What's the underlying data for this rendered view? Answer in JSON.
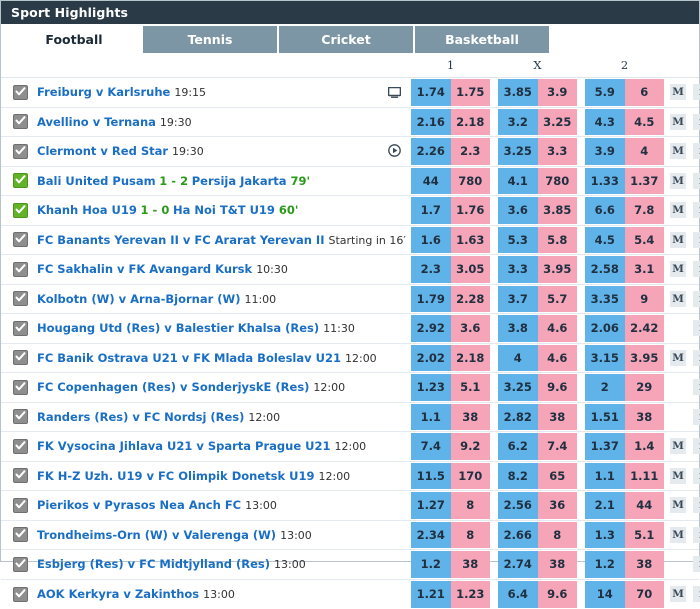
{
  "header": {
    "title": "Sport Highlights"
  },
  "tabs": [
    {
      "label": "Football",
      "active": true
    },
    {
      "label": "Tennis",
      "active": false
    },
    {
      "label": "Cricket",
      "active": false
    },
    {
      "label": "Basketball",
      "active": false
    }
  ],
  "column_headers": [
    "1",
    "X",
    "2"
  ],
  "buttons": {
    "more_label": "M",
    "info_label": "i"
  },
  "colors": {
    "titlebar": "#2b3a47",
    "tab_inactive": "#7d96a5",
    "odd_blue": "#5fb3e8",
    "odd_pink": "#f6a5b8",
    "team_link": "#1a6fc4",
    "live_green": "#2a9a18",
    "checkbox_gray": "#8e8e8e",
    "checkbox_green": "#62b32a"
  },
  "rows": [
    {
      "teams": "Freiburg v Karlsruhe",
      "time": "19:15",
      "live": false,
      "media": "tv-icon",
      "odds": [
        "1.74",
        "1.75",
        "3.85",
        "3.9",
        "5.9",
        "6"
      ],
      "more": true,
      "info": true
    },
    {
      "teams": "Avellino v Ternana",
      "time": "19:30",
      "live": false,
      "media": null,
      "odds": [
        "2.16",
        "2.18",
        "3.2",
        "3.25",
        "4.3",
        "4.5"
      ],
      "more": true,
      "info": true
    },
    {
      "teams": "Clermont v Red Star",
      "time": "19:30",
      "live": false,
      "media": "play-icon",
      "odds": [
        "2.26",
        "2.3",
        "3.25",
        "3.3",
        "3.9",
        "4"
      ],
      "more": true,
      "info": true
    },
    {
      "home": "Bali United Pusam",
      "away": "Persija Jakarta",
      "score": "1 - 2",
      "minute": "79'",
      "live": true,
      "media": null,
      "odds": [
        "44",
        "780",
        "4.1",
        "780",
        "1.33",
        "1.37"
      ],
      "more": true,
      "info": true
    },
    {
      "home": "Khanh Hoa U19",
      "away": "Ha Noi T&T U19",
      "score": "1 - 0",
      "minute": "60'",
      "live": true,
      "media": null,
      "odds": [
        "1.7",
        "1.76",
        "3.6",
        "3.85",
        "6.6",
        "7.8"
      ],
      "more": true,
      "info": true
    },
    {
      "teams": "FC Banants Yerevan II v FC Ararat Yerevan II",
      "starting": "Starting in 16′",
      "live": false,
      "media": null,
      "odds": [
        "1.6",
        "1.63",
        "5.3",
        "5.8",
        "4.5",
        "5.4"
      ],
      "more": true,
      "info": true
    },
    {
      "teams": "FC Sakhalin v FK Avangard Kursk",
      "time": "10:30",
      "live": false,
      "media": null,
      "odds": [
        "2.3",
        "3.05",
        "3.3",
        "3.95",
        "2.58",
        "3.1"
      ],
      "more": true,
      "info": true
    },
    {
      "teams": "Kolbotn (W) v Arna-Bjornar (W)",
      "time": "11:00",
      "live": false,
      "media": null,
      "odds": [
        "1.79",
        "2.28",
        "3.7",
        "5.7",
        "3.35",
        "9"
      ],
      "more": true,
      "info": true
    },
    {
      "teams": "Hougang Utd (Res) v Balestier Khalsa (Res)",
      "time": "11:30",
      "live": false,
      "media": null,
      "odds": [
        "2.92",
        "3.6",
        "3.8",
        "4.6",
        "2.06",
        "2.42"
      ],
      "more": false,
      "info": true
    },
    {
      "teams": "FC Banik Ostrava U21 v FK Mlada Boleslav U21",
      "time": "12:00",
      "live": false,
      "media": null,
      "odds": [
        "2.02",
        "2.18",
        "4",
        "4.6",
        "3.15",
        "3.95"
      ],
      "more": true,
      "info": true
    },
    {
      "teams": "FC Copenhagen (Res) v SonderjyskE (Res)",
      "time": "12:00",
      "live": false,
      "media": null,
      "odds": [
        "1.23",
        "5.1",
        "3.25",
        "9.6",
        "2",
        "29"
      ],
      "more": false,
      "info": true
    },
    {
      "teams": "Randers (Res) v FC Nordsj (Res)",
      "time": "12:00",
      "live": false,
      "media": null,
      "odds": [
        "1.1",
        "38",
        "2.82",
        "38",
        "1.51",
        "38"
      ],
      "more": false,
      "info": true
    },
    {
      "teams": "FK Vysocina Jihlava U21 v Sparta Prague U21",
      "time": "12:00",
      "live": false,
      "media": null,
      "odds": [
        "7.4",
        "9.2",
        "6.2",
        "7.4",
        "1.37",
        "1.4"
      ],
      "more": true,
      "info": true
    },
    {
      "teams": "FK H-Z Uzh. U19 v FC Olimpik Donetsk U19",
      "time": "12:00",
      "live": false,
      "media": null,
      "odds": [
        "11.5",
        "170",
        "8.2",
        "65",
        "1.1",
        "1.11"
      ],
      "more": true,
      "info": true
    },
    {
      "teams": "Pierikos v Pyrasos Nea Anch FC",
      "time": "13:00",
      "live": false,
      "media": null,
      "odds": [
        "1.27",
        "8",
        "2.56",
        "36",
        "2.1",
        "44"
      ],
      "more": true,
      "info": true
    },
    {
      "teams": "Trondheims-Orn (W) v Valerenga (W)",
      "time": "13:00",
      "live": false,
      "media": null,
      "odds": [
        "2.34",
        "8",
        "2.66",
        "8",
        "1.3",
        "5.1"
      ],
      "more": true,
      "info": true
    },
    {
      "teams": "Esbjerg (Res) v FC Midtjylland (Res)",
      "time": "13:00",
      "live": false,
      "media": null,
      "odds": [
        "1.2",
        "38",
        "2.74",
        "38",
        "1.2",
        "38"
      ],
      "more": false,
      "info": true
    },
    {
      "teams": "AOK Kerkyra v Zakinthos",
      "time": "13:00",
      "live": false,
      "media": null,
      "odds": [
        "1.21",
        "1.23",
        "6.4",
        "9.6",
        "14",
        "70"
      ],
      "more": true,
      "info": true
    }
  ]
}
